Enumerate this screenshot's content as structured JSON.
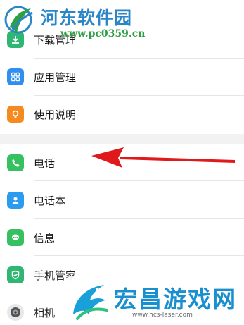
{
  "settings": {
    "items": [
      {
        "label": "下载管理",
        "icon": "download-icon",
        "color": "#2fb673"
      },
      {
        "label": "应用管理",
        "icon": "app-grid-icon",
        "color": "#2f8ff0"
      },
      {
        "label": "使用说明",
        "icon": "bulb-icon",
        "color": "#f58a1f"
      },
      {
        "label": "电话",
        "icon": "phone-icon",
        "color": "#35c15f"
      },
      {
        "label": "电话本",
        "icon": "contacts-icon",
        "color": "#2b9bf0"
      },
      {
        "label": "信息",
        "icon": "message-icon",
        "color": "#35c15f"
      },
      {
        "label": "手机管家",
        "icon": "shield-icon",
        "color": "#2fb673"
      },
      {
        "label": "相机",
        "icon": "camera-icon",
        "color": "#555555"
      }
    ]
  },
  "watermark_top": {
    "title": "河东软件园",
    "url": "www.pc0359.cn"
  },
  "watermark_bottom": {
    "title": "宏昌游戏网",
    "url": "www.hcs-laser.com"
  },
  "colors": {
    "background": "#f2f2f2",
    "arrow": "#e0191b"
  }
}
